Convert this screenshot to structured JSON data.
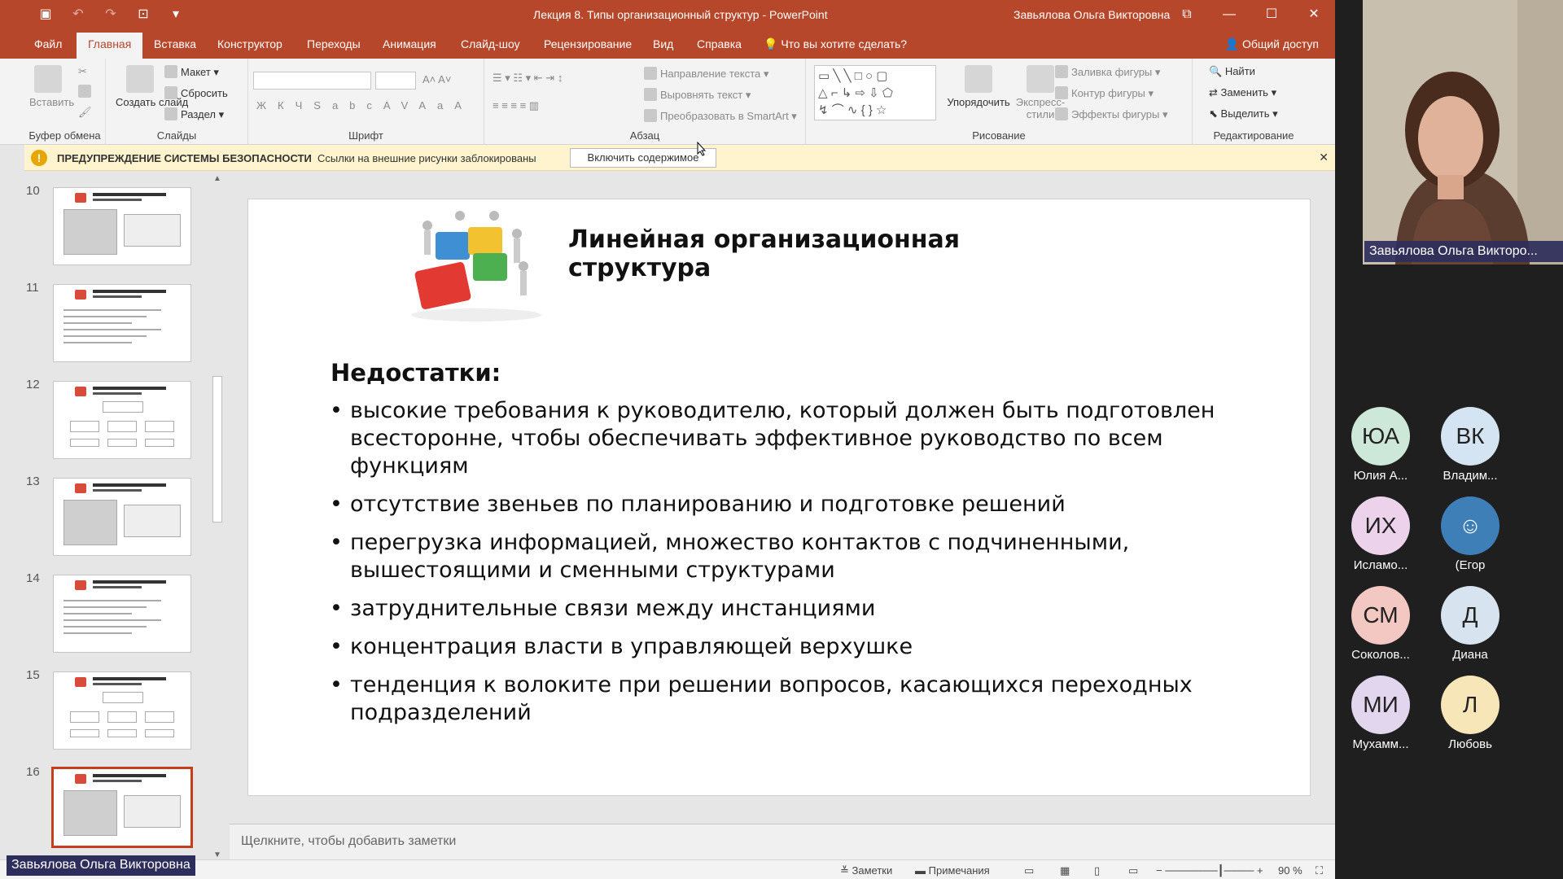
{
  "window": {
    "title": "Лекция 8. Типы организационный структур  -  PowerPoint",
    "user": "Завьялова Ольга Викторовна",
    "accent": "#b7472a"
  },
  "menu": {
    "tabs": [
      "Файл",
      "Главная",
      "Вставка",
      "Конструктор",
      "Переходы",
      "Анимация",
      "Слайд-шоу",
      "Рецензирование",
      "Вид",
      "Справка"
    ],
    "tell_me": "Что вы хотите сделать?",
    "share": "Общий доступ"
  },
  "ribbon": {
    "clipboard": {
      "paste": "Вставить",
      "label": "Буфер обмена"
    },
    "slides": {
      "new_slide": "Создать слайд",
      "layout": "Макет",
      "reset": "Сбросить",
      "section": "Раздел",
      "label": "Слайды"
    },
    "font": {
      "label": "Шрифт",
      "buttons": [
        "Ж",
        "К",
        "Ч",
        "S",
        "abc",
        "AV",
        "Aa",
        "A"
      ]
    },
    "paragraph": {
      "label": "Абзац",
      "text_direction": "Направление текста",
      "align_text": "Выровнять текст",
      "smartart": "Преобразовать в SmartArt"
    },
    "drawing": {
      "label": "Рисование",
      "arrange": "Упорядочить",
      "quick_styles": "Экспресс-стили",
      "shape_fill": "Заливка фигуры",
      "shape_outline": "Контур фигуры",
      "shape_effects": "Эффекты фигуры"
    },
    "editing": {
      "label": "Редактирование",
      "find": "Найти",
      "replace": "Заменить",
      "select": "Выделить"
    }
  },
  "warning": {
    "icon": "!",
    "title": "ПРЕДУПРЕЖДЕНИЕ СИСТЕМЫ БЕЗОПАСНОСТИ",
    "message": "Ссылки на внешние рисунки заблокированы",
    "button": "Включить содержимое",
    "close": "✕"
  },
  "thumbnails": [
    {
      "number": "10",
      "active": false
    },
    {
      "number": "11",
      "active": false
    },
    {
      "number": "12",
      "active": false
    },
    {
      "number": "13",
      "active": false
    },
    {
      "number": "14",
      "active": false
    },
    {
      "number": "15",
      "active": false
    },
    {
      "number": "16",
      "active": true
    }
  ],
  "slide": {
    "title": "Линейная организационная структура",
    "subtitle": "Недостатки:",
    "bullets": [
      "высокие требования к руководителю, который должен быть подготовлен всесторонне, чтобы обеспечивать эффективное руководство по всем функциям",
      "отсутствие звеньев по планированию и подготовке решений",
      "перегрузка информацией, множество контактов с подчиненными, вышестоящими и сменными структурами",
      "затруднительные связи между инстанциями",
      "концентрация власти в управляющей верхушке",
      "тенденция к волоките при решении вопросов, касающихся переходных подразделений"
    ]
  },
  "notes": {
    "placeholder": "Щелкните, чтобы добавить заметки"
  },
  "status": {
    "notes": "Заметки",
    "comments": "Примечания",
    "zoom": "90 %"
  },
  "presenter_label": "Завьялова Ольга Викторовна",
  "video": {
    "speaker_label": "Завьялова Ольга Викторо...",
    "participants": [
      {
        "initials": "ЮА",
        "name": "Юлия А...",
        "color": "#cde8d8"
      },
      {
        "initials": "ВК",
        "name": "Владим...",
        "color": "#d5e4f2"
      },
      {
        "initials": "ИХ",
        "name": "Исламо...",
        "color": "#ecd2ea"
      },
      {
        "initials": "",
        "name": "(Егор",
        "color": "#3f7fb8"
      },
      {
        "initials": "СМ",
        "name": "Соколов...",
        "color": "#f3c8c2"
      },
      {
        "initials": "Д",
        "name": "Диана",
        "color": "#d7e3ef"
      },
      {
        "initials": "МИ",
        "name": "Мухамм...",
        "color": "#e2d6ee"
      },
      {
        "initials": "Л",
        "name": "Любовь",
        "color": "#f6e6b8"
      }
    ]
  }
}
